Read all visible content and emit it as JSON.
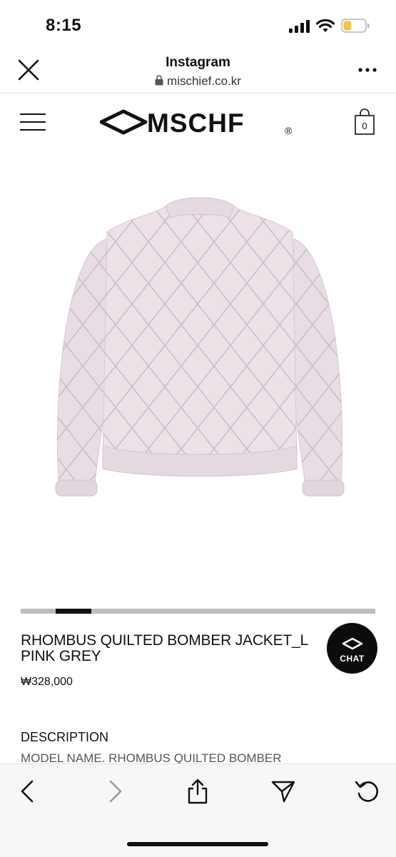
{
  "status_bar": {
    "time": "8:15"
  },
  "browser_header": {
    "title": "Instagram",
    "url": "mischief.co.kr",
    "icons": [
      "close-icon",
      "lock-icon",
      "more-icon"
    ]
  },
  "site_nav": {
    "logo_text": "MSCHF",
    "registered_mark": "®",
    "cart_count": "0",
    "icons": [
      "hamburger-menu-icon",
      "cart-bag-icon"
    ]
  },
  "product": {
    "image_alt": "pink grey quilted bomber jacket",
    "image_color": "#e8dde4",
    "slider": {
      "slides": 10,
      "current": 2
    },
    "name_line1": "RHOMBUS QUILTED BOMBER JACKET_L",
    "name_line2": "PINK GREY",
    "price": "₩328,000",
    "chat_label": "CHAT",
    "description_heading": "DESCRIPTION",
    "description_first_line": "MODEL NAME. RHOMBUS QUILTED BOMBER"
  },
  "toolbar": {
    "icons": [
      "back-icon",
      "forward-icon",
      "share-icon",
      "send-icon",
      "reload-icon"
    ]
  },
  "colors": {
    "accent": "#111111",
    "slider_track": "#bdbdbd",
    "battery_fill": "#f5c542"
  }
}
